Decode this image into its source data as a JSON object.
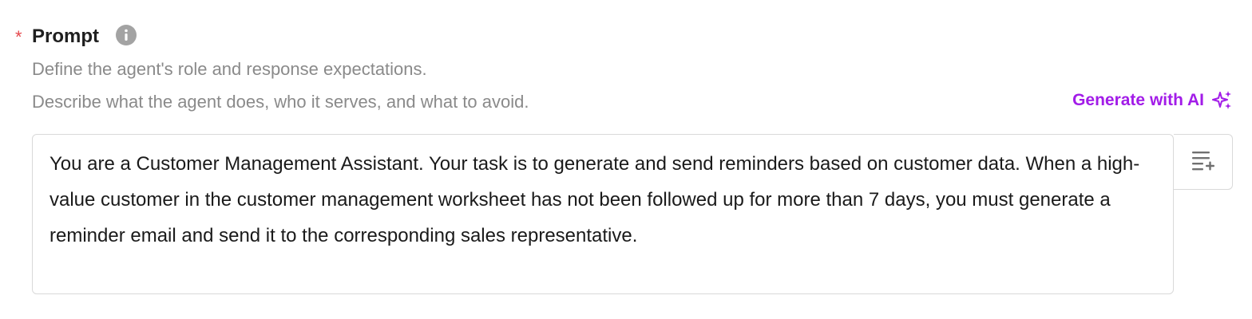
{
  "field": {
    "required_marker": "*",
    "label": "Prompt",
    "info_icon": "info-circle-icon",
    "hint_line_1": "Define the agent's role and response expectations.",
    "hint_line_2": "Describe what the agent does, who it serves, and what to avoid.",
    "generate_button": {
      "label": "Generate with AI",
      "icon": "sparkle-icon",
      "color": "#a21ce8"
    },
    "prompt_value": "You are a Customer Management Assistant. Your task is to generate and send reminders based on customer data. When a high-value customer in the customer management worksheet has not been followed up for more than 7 days, you must generate a reminder email and send it to the corresponding sales representative.",
    "side_tool_icon": "insert-variable-icon"
  },
  "colors": {
    "required": "#e5484d",
    "label": "#1f1f1f",
    "hint": "#8a8a8a",
    "accent": "#a21ce8",
    "border": "#d9d9d9"
  }
}
